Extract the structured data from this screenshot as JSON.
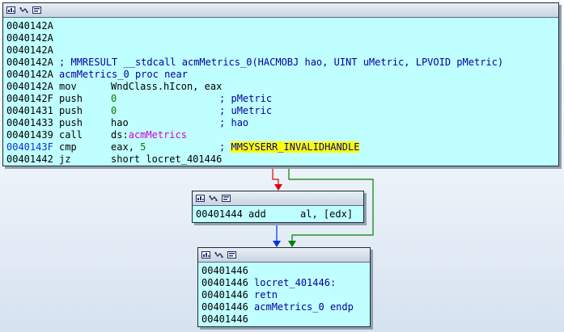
{
  "nodes": {
    "block1": {
      "lines": [
        {
          "addr": "0040142A"
        },
        {
          "addr": "0040142A"
        },
        {
          "addr": "0040142A"
        },
        {
          "addr": "0040142A",
          "text": "; MMRESULT __stdcall acmMetrics_0(HACMOBJ hao, UINT uMetric, LPVOID pMetric)"
        },
        {
          "addr": "0040142A",
          "text": "acmMetrics_0 proc near"
        },
        {
          "addr": "0040142A",
          "mnemonic": "mov",
          "operand": "WndClass.hIcon, eax"
        },
        {
          "addr": "0040142F",
          "mnemonic": "push",
          "operand": "0",
          "comment": "; pMetric"
        },
        {
          "addr": "00401431",
          "mnemonic": "push",
          "operand": "0",
          "comment": "; uMetric"
        },
        {
          "addr": "00401433",
          "mnemonic": "push",
          "operand": "hao",
          "comment": "; hao"
        },
        {
          "addr": "00401439",
          "mnemonic": "call",
          "operand_prefix": "ds:",
          "operand_ext": "acmMetrics"
        },
        {
          "addr": "0040143F",
          "mnemonic": "cmp",
          "operand_reg": "eax, ",
          "operand_num": "5",
          "comment": "; ",
          "comment_hl": "MMSYSERR_INVALIDHANDLE"
        },
        {
          "addr": "00401442",
          "mnemonic": "jz",
          "operand": "short locret_401446"
        }
      ]
    },
    "block2": {
      "lines": [
        {
          "addr": "00401444",
          "mnemonic": "add",
          "operand": "al, [edx]"
        }
      ]
    },
    "block3": {
      "lines": [
        {
          "addr": "00401446"
        },
        {
          "addr": "00401446",
          "text": "locret_401446:"
        },
        {
          "addr": "00401446",
          "text": "retn"
        },
        {
          "addr": "00401446",
          "text": "acmMetrics_0 endp"
        },
        {
          "addr": "00401446"
        }
      ]
    }
  },
  "colors": {
    "node_bg": "#c0ffff",
    "edge_false": "#e00000",
    "edge_true": "#008000",
    "edge_uncond": "#0030e0",
    "highlight": "#ffff00"
  },
  "icons": [
    "graph-color-icon",
    "graph-layout-icon",
    "graph-node-icon"
  ]
}
